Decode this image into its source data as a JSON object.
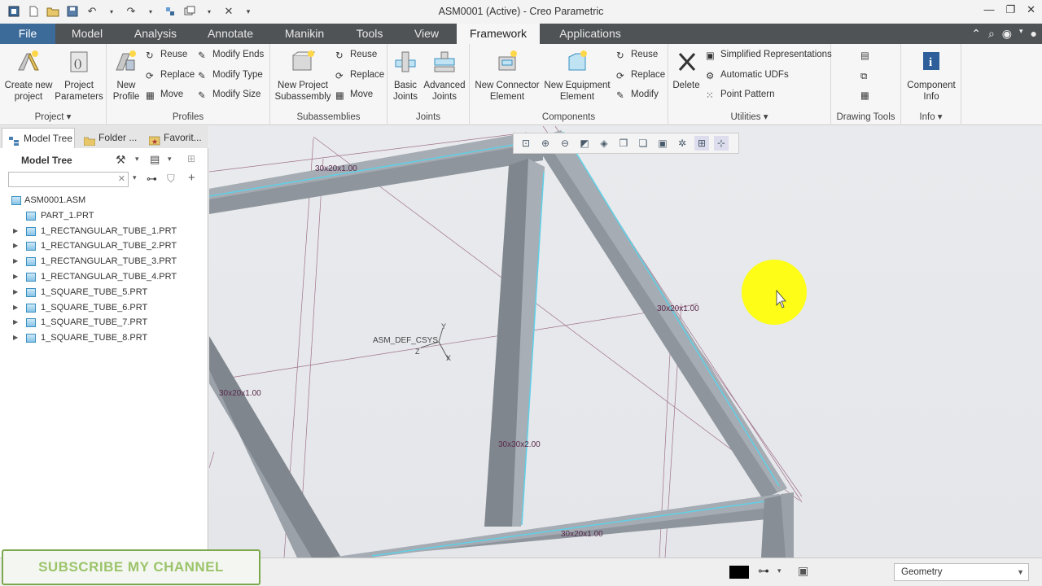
{
  "window": {
    "title": "ASM0001 (Active) - Creo Parametric"
  },
  "tabs": [
    {
      "label": "File"
    },
    {
      "label": "Model"
    },
    {
      "label": "Analysis"
    },
    {
      "label": "Annotate"
    },
    {
      "label": "Manikin"
    },
    {
      "label": "Tools"
    },
    {
      "label": "View"
    },
    {
      "label": "Framework"
    },
    {
      "label": "Applications"
    }
  ],
  "ribbon": {
    "project": {
      "label": "Project",
      "create_new": "Create new\nproject",
      "parameters": "Project\nParameters"
    },
    "profiles": {
      "label": "Profiles",
      "new_profile": "New\nProfile",
      "reuse": "Reuse",
      "replace": "Replace",
      "move": "Move",
      "modify_ends": "Modify Ends",
      "modify_type": "Modify Type",
      "modify_size": "Modify Size"
    },
    "subassemblies": {
      "label": "Subassemblies",
      "new_project": "New Project\nSubassembly",
      "reuse": "Reuse",
      "replace": "Replace",
      "move": "Move"
    },
    "joints": {
      "label": "Joints",
      "basic": "Basic\nJoints",
      "advanced": "Advanced\nJoints"
    },
    "components": {
      "label": "Components",
      "new_connector": "New Connector\nElement",
      "new_equipment": "New Equipment\nElement",
      "reuse": "Reuse",
      "replace": "Replace",
      "modify": "Modify"
    },
    "utilities": {
      "label": "Utilities",
      "delete": "Delete",
      "simplified": "Simplified Representations",
      "auto_udfs": "Automatic UDFs",
      "point_pattern": "Point Pattern"
    },
    "drawing_tools": {
      "label": "Drawing Tools"
    },
    "info": {
      "label": "Info",
      "component_info": "Component\nInfo"
    }
  },
  "panel": {
    "tabs": [
      "Model Tree",
      "Folder ...",
      "Favorit..."
    ],
    "tree_label": "Model Tree",
    "search_placeholder": "",
    "items": [
      {
        "label": "ASM0001.ASM",
        "expandable": false,
        "root": true
      },
      {
        "label": "PART_1.PRT",
        "expandable": false
      },
      {
        "label": "1_RECTANGULAR_TUBE_1.PRT",
        "expandable": true
      },
      {
        "label": "1_RECTANGULAR_TUBE_2.PRT",
        "expandable": true
      },
      {
        "label": "1_RECTANGULAR_TUBE_3.PRT",
        "expandable": true
      },
      {
        "label": "1_RECTANGULAR_TUBE_4.PRT",
        "expandable": true
      },
      {
        "label": "1_SQUARE_TUBE_5.PRT",
        "expandable": true
      },
      {
        "label": "1_SQUARE_TUBE_6.PRT",
        "expandable": true
      },
      {
        "label": "1_SQUARE_TUBE_7.PRT",
        "expandable": true
      },
      {
        "label": "1_SQUARE_TUBE_8.PRT",
        "expandable": true
      }
    ]
  },
  "viewport": {
    "dims": {
      "d1": "30x20x1.00",
      "d2": "30x20x1.00",
      "d3": "30x20x1.00",
      "d4": "30x30x2.00",
      "d5": "30x20x1.00"
    },
    "csys_label": "ASM_DEF_CSYS",
    "axis_y": "Y",
    "axis_z": "Z",
    "axis_x": "X"
  },
  "status": {
    "filter_value": "Geometry",
    "overlay_text": "SUBSCRIBE MY CHANNEL"
  },
  "colors": {
    "file_tab": "#3c6a99",
    "tab_bar": "#505356",
    "beam_edge": "#5fd0e8",
    "cursor_highlight": "#ffff00"
  }
}
